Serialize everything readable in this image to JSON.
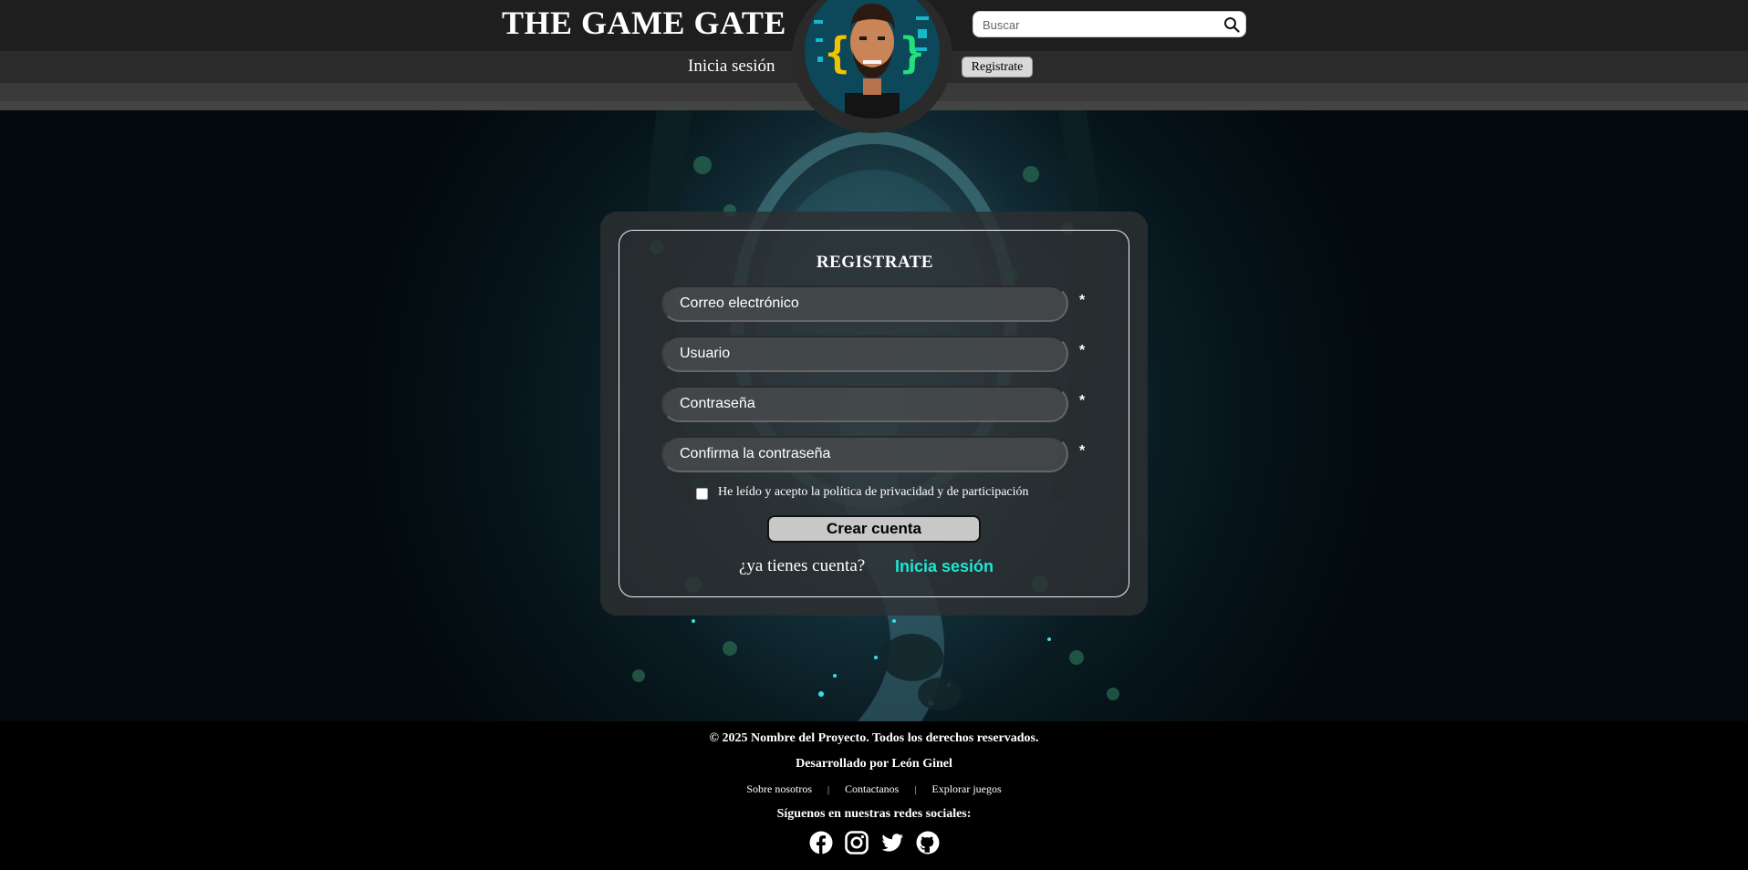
{
  "header": {
    "site_title": "THE GAME GATE",
    "search_placeholder": "Buscar",
    "login_link": "Inicia sesión",
    "register_button": "Registrate"
  },
  "form": {
    "title": "REGISTRATE",
    "fields": [
      {
        "placeholder": "Correo electrónico",
        "value": "",
        "required": "*"
      },
      {
        "placeholder": "Usuario",
        "value": "",
        "required": "*"
      },
      {
        "placeholder": "Contraseña",
        "value": "",
        "required": "*"
      },
      {
        "placeholder": "Confirma la contraseña",
        "value": "",
        "required": "*"
      }
    ],
    "privacy_checkbox_label": "He leído y acepto la política de privacidad y de participación",
    "privacy_checked": false,
    "submit_button": "Crear cuenta",
    "has_account_text": "¿ya tienes cuenta?",
    "login_link": "Inicia sesión"
  },
  "footer": {
    "copyright": "© 2025 Nombre del Proyecto. Todos los derechos reservados.",
    "developer": "Desarrollado por León Ginel",
    "links": [
      "Sobre nosotros",
      "Contactanos",
      "Explorar juegos"
    ],
    "separator": "|",
    "social_heading": "Síguenos en nuestras redes sociales:",
    "social_icons": [
      "facebook-icon",
      "instagram-icon",
      "twitter-icon",
      "github-icon"
    ]
  },
  "colors": {
    "accent": "#1ee6d2",
    "header_top": "#1e1e1e",
    "header_mid": "#2b2b2b",
    "card_bg": "#2d3032",
    "footer_bg": "#000000"
  }
}
